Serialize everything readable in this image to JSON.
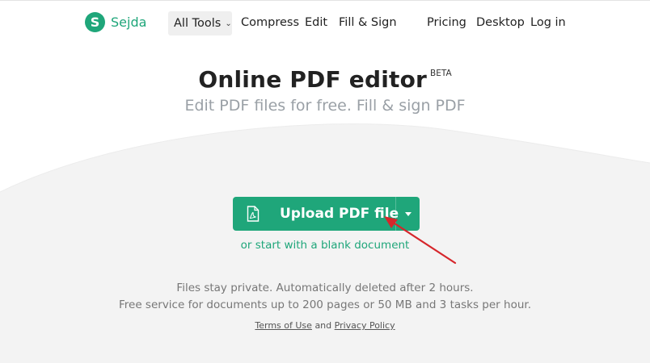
{
  "brand": {
    "name": "Sejda",
    "mark": "S",
    "color": "#1fa67a"
  },
  "nav": {
    "all_tools": "All Tools",
    "compress": "Compress",
    "edit": "Edit",
    "fill_sign": "Fill & Sign",
    "pricing": "Pricing",
    "desktop": "Desktop",
    "login": "Log in"
  },
  "hero": {
    "title": "Online PDF editor",
    "badge": "BETA",
    "subtitle": "Edit PDF files for free. Fill & sign PDF"
  },
  "upload": {
    "label": "Upload PDF file",
    "icon": "pdf-file-icon",
    "dropdown_icon": "caret-down-icon",
    "blank_link": "or start with a blank document"
  },
  "info": {
    "line1": "Files stay private. Automatically deleted after 2 hours.",
    "line2": "Free service for documents up to 200 pages or 50 MB and 3 tasks per hour."
  },
  "legal": {
    "terms": "Terms of Use",
    "and": "and",
    "privacy": "Privacy Policy"
  },
  "annotation": {
    "icon": "red-arrow-annotation",
    "color": "#d6262b"
  }
}
